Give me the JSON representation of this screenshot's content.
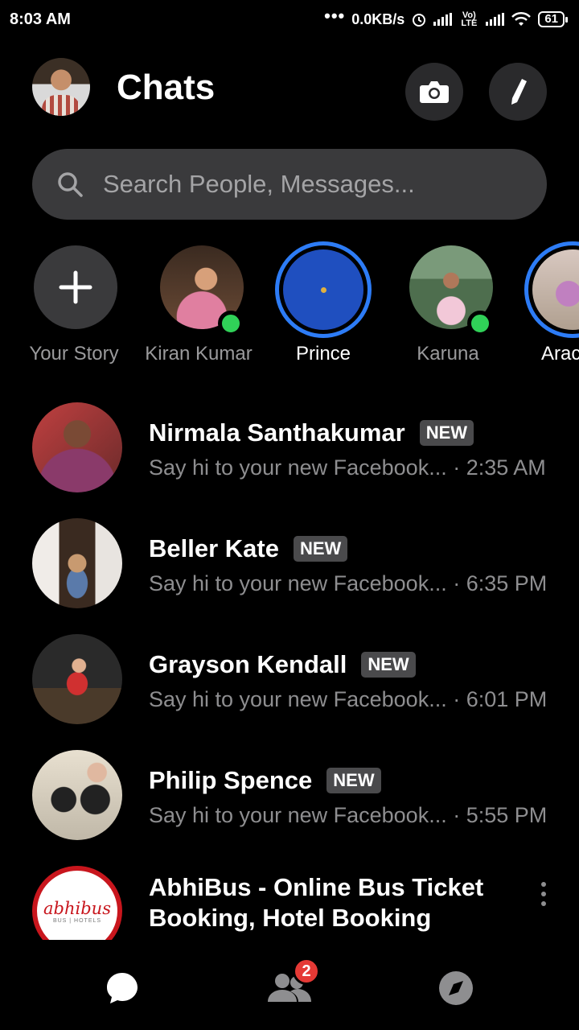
{
  "status_bar": {
    "time": "8:03 AM",
    "dots": "•••",
    "network_speed": "0.0KB/s",
    "lte_label": "Vo) LTE",
    "battery": "61"
  },
  "header": {
    "title": "Chats",
    "camera_icon": "camera-icon",
    "compose_icon": "pencil-icon"
  },
  "search": {
    "placeholder": "Search People, Messages..."
  },
  "stories": [
    {
      "label": "Your Story",
      "type": "add"
    },
    {
      "label": "Kiran Kumar",
      "online": true
    },
    {
      "label": "Prince",
      "active_story": true
    },
    {
      "label": "Karuna",
      "online": true
    },
    {
      "label": "Arac",
      "active_story": true
    }
  ],
  "chats": [
    {
      "name": "Nirmala Santhakumar",
      "badge": "NEW",
      "preview": "Say hi to your new Facebook... · 2:35 AM"
    },
    {
      "name": "Beller Kate",
      "badge": "NEW",
      "preview": "Say hi to your new Facebook... · 6:35 PM"
    },
    {
      "name": "Grayson Kendall",
      "badge": "NEW",
      "preview": "Say hi to your new Facebook... · 6:01 PM"
    },
    {
      "name": "Philip Spence",
      "badge": "NEW",
      "preview": "Say hi to your new Facebook... · 5:55 PM"
    },
    {
      "name": "AbhiBus - Online Bus Ticket Booking, Hotel Booking",
      "logo_text": "abhibus",
      "logo_sub": "BUS | HOTELS"
    }
  ],
  "bottom_nav": {
    "people_badge": "2"
  },
  "colors": {
    "background": "#000000",
    "story_ring": "#2d7cf6",
    "online": "#30d158",
    "badge_red": "#e53935"
  }
}
